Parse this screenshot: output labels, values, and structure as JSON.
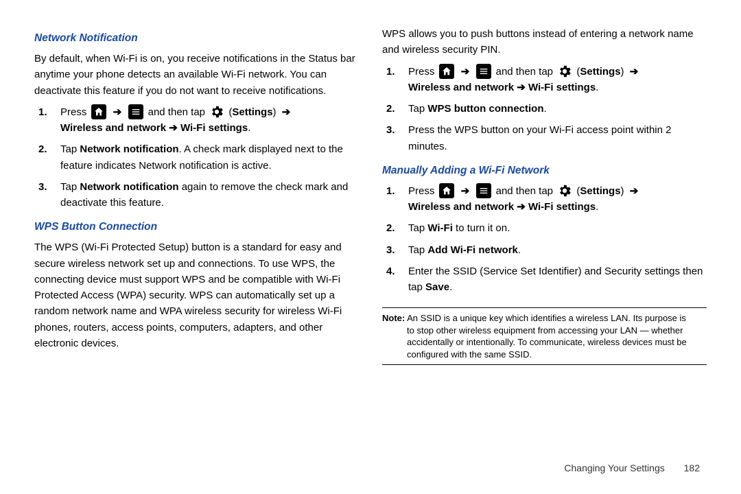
{
  "left": {
    "h1": "Network Notification",
    "p1": "By default, when Wi-Fi is on, you receive notifications in the Status bar anytime your phone detects an available Wi-Fi network. You can deactivate this feature if you do not want to receive notifications.",
    "steps1": {
      "s1_a": "Press ",
      "s1_b": " and then tap ",
      "s1_c": " (",
      "s1_settings": "Settings",
      "s1_d": ") ",
      "s1_path": "Wireless and network ➔ Wi-Fi settings",
      "s1_end": ".",
      "s2_a": "Tap ",
      "s2_b": "Network notification",
      "s2_c": ". A check mark displayed next to the feature indicates Network notification is active.",
      "s3_a": "Tap ",
      "s3_b": "Network notification",
      "s3_c": " again to remove the check mark and deactivate this feature."
    },
    "h2": "WPS Button Connection",
    "p2": "The WPS (Wi-Fi Protected Setup) button is a standard for easy and secure wireless network set up and connections. To use WPS, the connecting device must support WPS and be compatible with Wi-Fi Protected Access (WPA) security. WPS can automatically set up a random network name and WPA wireless security for wireless Wi-Fi phones, routers, access points, computers, adapters, and other electronic devices."
  },
  "right": {
    "p1": "WPS allows you to push buttons instead of entering a network name and wireless security PIN.",
    "steps1": {
      "s1_a": "Press ",
      "s1_b": " and then tap ",
      "s1_c": " (",
      "s1_settings": "Settings",
      "s1_d": ") ",
      "s1_path": "Wireless and network ➔ Wi-Fi settings",
      "s1_end": ".",
      "s2_a": "Tap ",
      "s2_b": "WPS button connection",
      "s2_c": ".",
      "s3": "Press the WPS button on your Wi-Fi access point within 2 minutes."
    },
    "h1": "Manually Adding a Wi-Fi Network",
    "steps2": {
      "s1_a": "Press ",
      "s1_b": " and then tap ",
      "s1_c": " (",
      "s1_settings": "Settings",
      "s1_d": ") ",
      "s1_path": "Wireless and network ➔ Wi-Fi settings",
      "s1_end": ".",
      "s2_a": "Tap ",
      "s2_b": "Wi-Fi",
      "s2_c": " to turn it on.",
      "s3_a": "Tap ",
      "s3_b": "Add Wi-Fi network",
      "s3_c": ".",
      "s4_a": "Enter the SSID (Service Set Identifier) and Security settings then tap ",
      "s4_b": "Save",
      "s4_c": "."
    },
    "note_label": "Note:",
    "note_first": " An SSID is a unique key which identifies a wireless LAN. Its purpose is",
    "note_body": "to stop other wireless equipment from accessing your LAN — whether accidentally or intentionally. To communicate, wireless devices must be configured with the same SSID."
  },
  "footer": {
    "chapter": "Changing Your Settings",
    "page": "182"
  },
  "icons": {
    "arrow": "➔"
  }
}
